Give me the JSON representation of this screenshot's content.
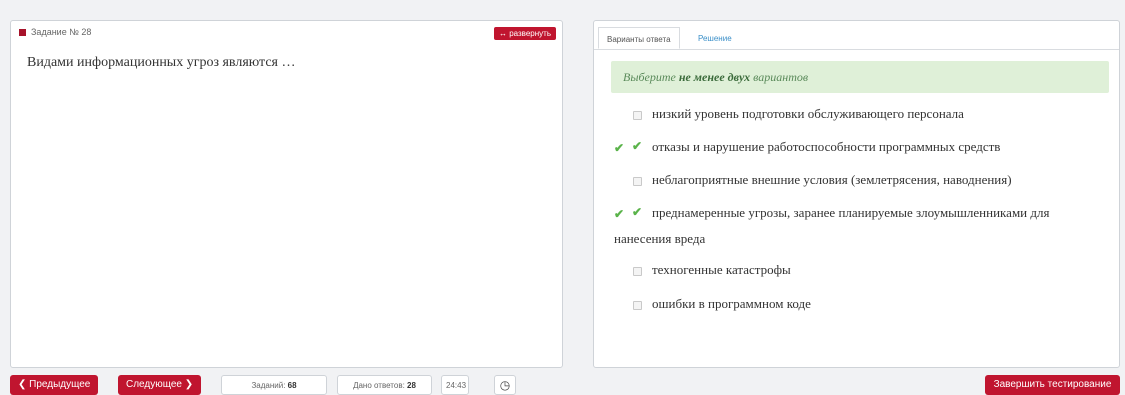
{
  "task": {
    "label": "Задание № 28",
    "expand_label": "↔ развернуть",
    "question": "Видами информационных угроз являются …"
  },
  "tabs": [
    {
      "label": "Варианты ответа",
      "active": true
    },
    {
      "label": "Решение",
      "active": false
    }
  ],
  "hint": {
    "prefix": "Выберите",
    "emphasis": "не менее двух",
    "suffix": "вариантов"
  },
  "options": [
    {
      "text": "низкий уровень подготовки обслуживающего персонала",
      "checked": false,
      "correct": false
    },
    {
      "text": "отказы и нарушение работоспособности программных средств",
      "checked": true,
      "correct": true
    },
    {
      "text": "неблагоприятные внешние условия (землетрясения, наводнения)",
      "checked": false,
      "correct": false
    },
    {
      "text": "преднамеренные угрозы, заранее планируемые злоумышленниками для",
      "text2": "нанесения вреда",
      "checked": true,
      "correct": true
    },
    {
      "text": "техногенные катастрофы",
      "checked": false,
      "correct": false
    },
    {
      "text": "ошибки в программном коде",
      "checked": false,
      "correct": false
    }
  ],
  "footer": {
    "prev_label": "❮ Предыдущее",
    "next_label": "Следующее ❯",
    "tasks_label": "Заданий:",
    "tasks_value": "68",
    "answers_label": "Дано ответов:",
    "answers_value": "28",
    "timer": "24:43",
    "finish_label": "Завершить тестирование"
  },
  "colors": {
    "accent": "#c0152f",
    "hint_bg": "#dff0d8",
    "check": "#5ab34a",
    "link": "#3a8fc8"
  }
}
